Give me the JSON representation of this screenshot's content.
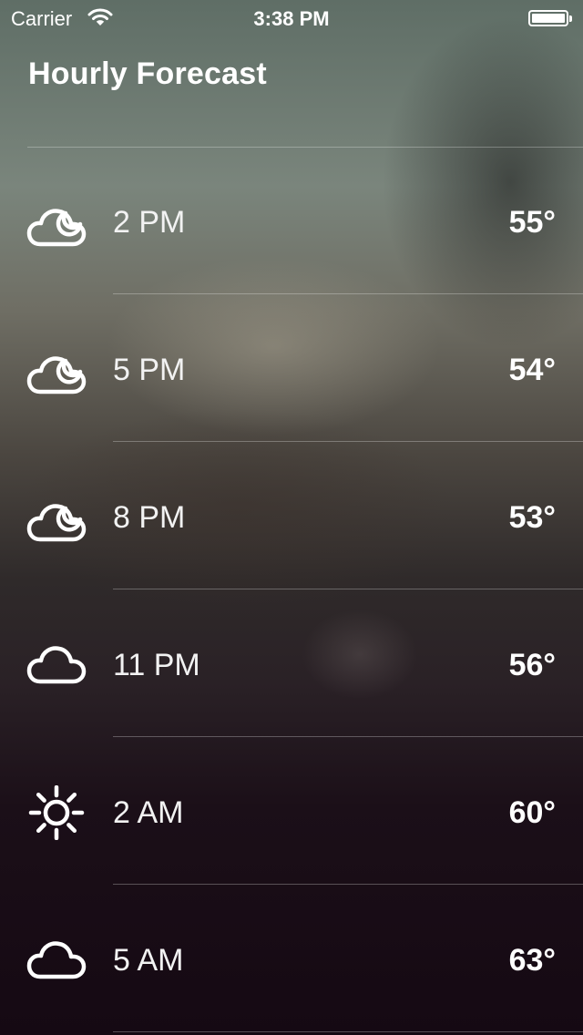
{
  "status_bar": {
    "carrier": "Carrier",
    "time": "3:38 PM",
    "icons": [
      "wifi-icon",
      "battery-icon"
    ]
  },
  "page_title": "Hourly Forecast",
  "forecast": [
    {
      "hour": "2 PM",
      "temperature": "55°",
      "icon": "partly-cloudy-night-icon"
    },
    {
      "hour": "5 PM",
      "temperature": "54°",
      "icon": "partly-cloudy-night-icon"
    },
    {
      "hour": "8 PM",
      "temperature": "53°",
      "icon": "partly-cloudy-night-icon"
    },
    {
      "hour": "11 PM",
      "temperature": "56°",
      "icon": "cloud-icon"
    },
    {
      "hour": "2 AM",
      "temperature": "60°",
      "icon": "sun-icon"
    },
    {
      "hour": "5 AM",
      "temperature": "63°",
      "icon": "cloud-icon"
    }
  ],
  "colors": {
    "text": "#ffffff",
    "divider": "rgba(255,255,255,0.28)",
    "background_bottom": "#150913"
  }
}
